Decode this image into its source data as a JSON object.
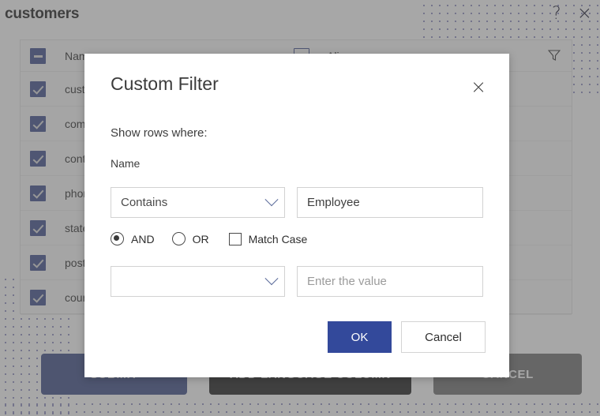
{
  "window": {
    "title": "customers",
    "help_icon": "?",
    "close_icon": "×"
  },
  "table": {
    "columns": [
      "Name",
      "Alias"
    ],
    "filter_icon": "filter-icon",
    "header_checkbox_state": "indeterminate",
    "alias_header_checkbox_state": "empty",
    "rows": [
      {
        "name": "customer_id",
        "checked": true,
        "alias": ""
      },
      {
        "name": "company_name",
        "checked": true,
        "alias": ""
      },
      {
        "name": "contact_name",
        "checked": true,
        "alias": ""
      },
      {
        "name": "phone",
        "checked": true,
        "alias": ""
      },
      {
        "name": "state",
        "checked": true,
        "alias": ""
      },
      {
        "name": "postal_code",
        "checked": true,
        "alias": ""
      },
      {
        "name": "country",
        "checked": true,
        "alias": ""
      }
    ]
  },
  "actions": {
    "submit_label": "SUBMIT",
    "add_language_label": "ADD LANGUAGE COLUMN",
    "cancel_label": "CANCEL"
  },
  "dialog": {
    "title": "Custom Filter",
    "close_icon": "×",
    "prompt": "Show rows where:",
    "field_label": "Name",
    "condition1": {
      "operator": "Contains",
      "value": "Employee",
      "value_placeholder": ""
    },
    "logic": {
      "and_label": "AND",
      "or_label": "OR",
      "selected": "AND",
      "match_case_label": "Match Case",
      "match_case_checked": false
    },
    "condition2": {
      "operator": "",
      "value": "",
      "value_placeholder": "Enter the value"
    },
    "ok_label": "OK",
    "cancel_label": "Cancel"
  },
  "colors": {
    "primary": "#33499b",
    "checkbox": "#3c4c8c",
    "submit": "#3a4a86",
    "add_language": "#1b1b1b",
    "cancel": "#6f6f6f",
    "dots": "#8e8fc0"
  }
}
